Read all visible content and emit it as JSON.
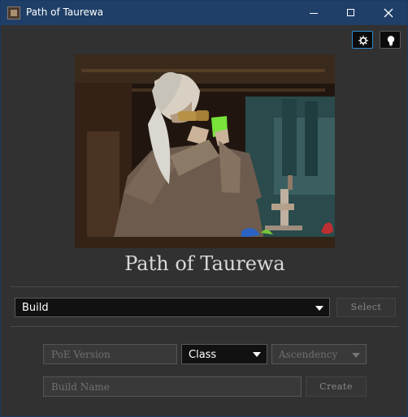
{
  "window": {
    "title": "Path of Taurewa"
  },
  "icons": {
    "app": "app-icon",
    "settings": "gear-icon",
    "hint": "lightbulb-icon",
    "minimize": "minimize-icon",
    "maximize": "maximize-icon",
    "close": "close-icon",
    "dropdown": "chevron-down-icon"
  },
  "app": {
    "heading": "Path of Taurewa"
  },
  "build_selector": {
    "selected": "Build",
    "button": "Select"
  },
  "create_form": {
    "version_placeholder": "PoE Version",
    "class_selected": "Class",
    "ascendency_selected": "Ascendency",
    "build_name_placeholder": "Build Name",
    "button": "Create"
  },
  "colors": {
    "titlebar": "#1f3f68",
    "background": "#313131",
    "active_border": "#2f8bd0"
  }
}
